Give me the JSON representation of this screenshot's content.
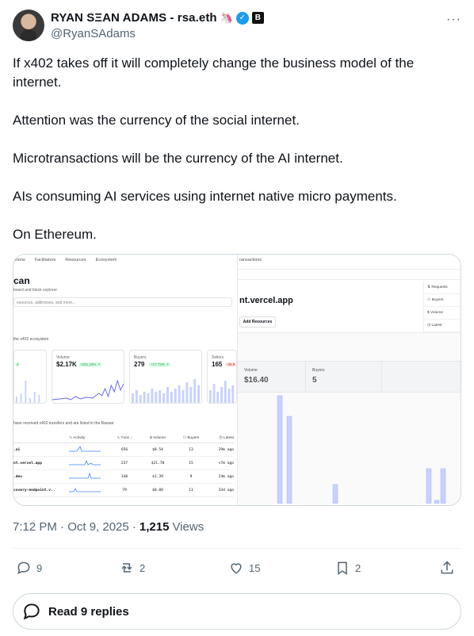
{
  "author": {
    "display_name": "RYAN SΞAN ADAMS - rsa.eth",
    "emoji": "🦄",
    "verified_mark": "✓",
    "badge": "B",
    "handle": "@RyanSAdams",
    "more": "···"
  },
  "tweet": {
    "paragraphs": [
      "If x402 takes off it will completely change the business model of the internet.",
      "Attention was the currency of the social internet.",
      "Microtransactions will be the currency of the AI internet.",
      "AIs consuming AI services using internet native micro payments.",
      "On Ethereum."
    ]
  },
  "left_screenshot": {
    "nav": [
      "ations",
      "Facilitators",
      "Resources",
      "Ecosystem"
    ],
    "title": "can",
    "subtitle": "board and block explorer",
    "search_placeholder": "esources, addresses, and more...",
    "eco_label": "the x402 ecosystem",
    "cards": [
      {
        "label": "",
        "value": "",
        "delta": "s"
      },
      {
        "label": "Volume",
        "value": "$2.17K",
        "delta": "+231.23% ↗"
      },
      {
        "label": "Buyers",
        "value": "279",
        "delta": "+17.72% ↗"
      },
      {
        "label": "Sellers",
        "value": "165",
        "delta": "-35.9"
      }
    ],
    "desc": "have received x402 transfers and are listed in the Bazaar",
    "table_headers": [
      "",
      "∿ Activity",
      "∿ Txns ↓",
      "$ Volume",
      "⚇ Buyers",
      "◷ Latest"
    ],
    "rows": [
      {
        "name": ".ai",
        "txns": "656",
        "volume": "$0.54",
        "buyers": "13",
        "latest": "29m ago"
      },
      {
        "name": "nt.vercel.app",
        "txns": "237",
        "volume": "$21.78",
        "buyers": "15",
        "latest": "<7m ago"
      },
      {
        "name": ".dev",
        "txns": "140",
        "volume": "$1.39",
        "buyers": "9",
        "latest": "24m ago"
      },
      {
        "name": "covery-endpoint.v..",
        "txns": "79",
        "volume": "$0.08",
        "buyers": "11",
        "latest": "33d ago"
      }
    ]
  },
  "right_screenshot": {
    "top_label": "ransactions",
    "title": "nt.vercel.app",
    "add_button": "Add Resources",
    "menu": [
      "⇅ Requests",
      "⚇ Buyers",
      "$ Volume",
      "◷ Latest"
    ],
    "stats": [
      {
        "label": "Volume",
        "value": "$16.40"
      },
      {
        "label": "Buyers",
        "value": "5"
      }
    ]
  },
  "meta": {
    "time": "7:12 PM · Oct 9, 2025 ·",
    "views_count": "1,215",
    "views_label": "Views"
  },
  "actions": {
    "replies": "9",
    "reposts": "2",
    "likes": "15",
    "bookmarks": "2"
  },
  "read_replies": "Read 9 replies",
  "colors": {
    "text_primary": "#0f1419",
    "text_secondary": "#536471",
    "verified_blue": "#1d9bf0",
    "border": "#cfd9de",
    "chart_bar": "#c7d2fe"
  }
}
